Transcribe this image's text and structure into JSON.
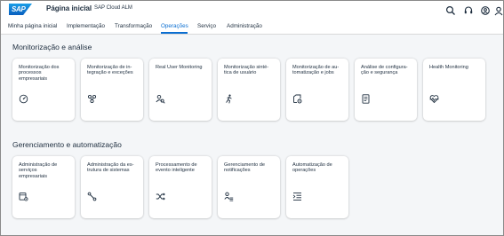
{
  "header": {
    "logo_text": "SAP",
    "title": "Página inicial",
    "subtitle": "SAP Cloud ALM",
    "icons": [
      "search-icon",
      "headset-icon",
      "user-settings-icon",
      "user-avatar-icon"
    ]
  },
  "tabs": [
    {
      "label": "Minha página inicial",
      "active": false
    },
    {
      "label": "Implementação",
      "active": false
    },
    {
      "label": "Transformação",
      "active": false
    },
    {
      "label": "Operações",
      "active": true
    },
    {
      "label": "Serviço",
      "active": false
    },
    {
      "label": "Administração",
      "active": false
    }
  ],
  "sections": [
    {
      "title": "Monitorização e análise",
      "tiles": [
        {
          "title": "Monitorização dos\nprocessos\nempresariais",
          "icon": "gauge-icon"
        },
        {
          "title": "Monitorização de in-\ntegração e exceções",
          "icon": "integration-icon"
        },
        {
          "title": "Real User Monitoring",
          "icon": "user-search-icon"
        },
        {
          "title": "Monitorização sinté-\ntica de usuário",
          "icon": "running-person-icon"
        },
        {
          "title": "Monitorização de au-\ntomatização e jobs",
          "icon": "job-automation-icon"
        },
        {
          "title": "Análise de configura-\nção e segurança",
          "icon": "checklist-icon"
        },
        {
          "title": "Health Monitoring",
          "icon": "heart-pulse-icon"
        }
      ]
    },
    {
      "title": "Gerenciamento e automatização",
      "tiles": [
        {
          "title": "Administração de\nserviços\nempresariais",
          "icon": "calendar-settings-icon"
        },
        {
          "title": "Administração da es-\ntrutura de sistemas",
          "icon": "network-icon"
        },
        {
          "title": "Processamento de\nevento inteligente",
          "icon": "shuffle-icon"
        },
        {
          "title": "Gerenciamento de\nnotificações",
          "icon": "person-list-icon"
        },
        {
          "title": "Automatização de\noperações",
          "icon": "indent-list-icon"
        }
      ]
    }
  ],
  "colors": {
    "accent": "#0a6ed1",
    "text": "#1d2d3e",
    "background": "#f4f6f8",
    "tile": "#ffffff"
  }
}
